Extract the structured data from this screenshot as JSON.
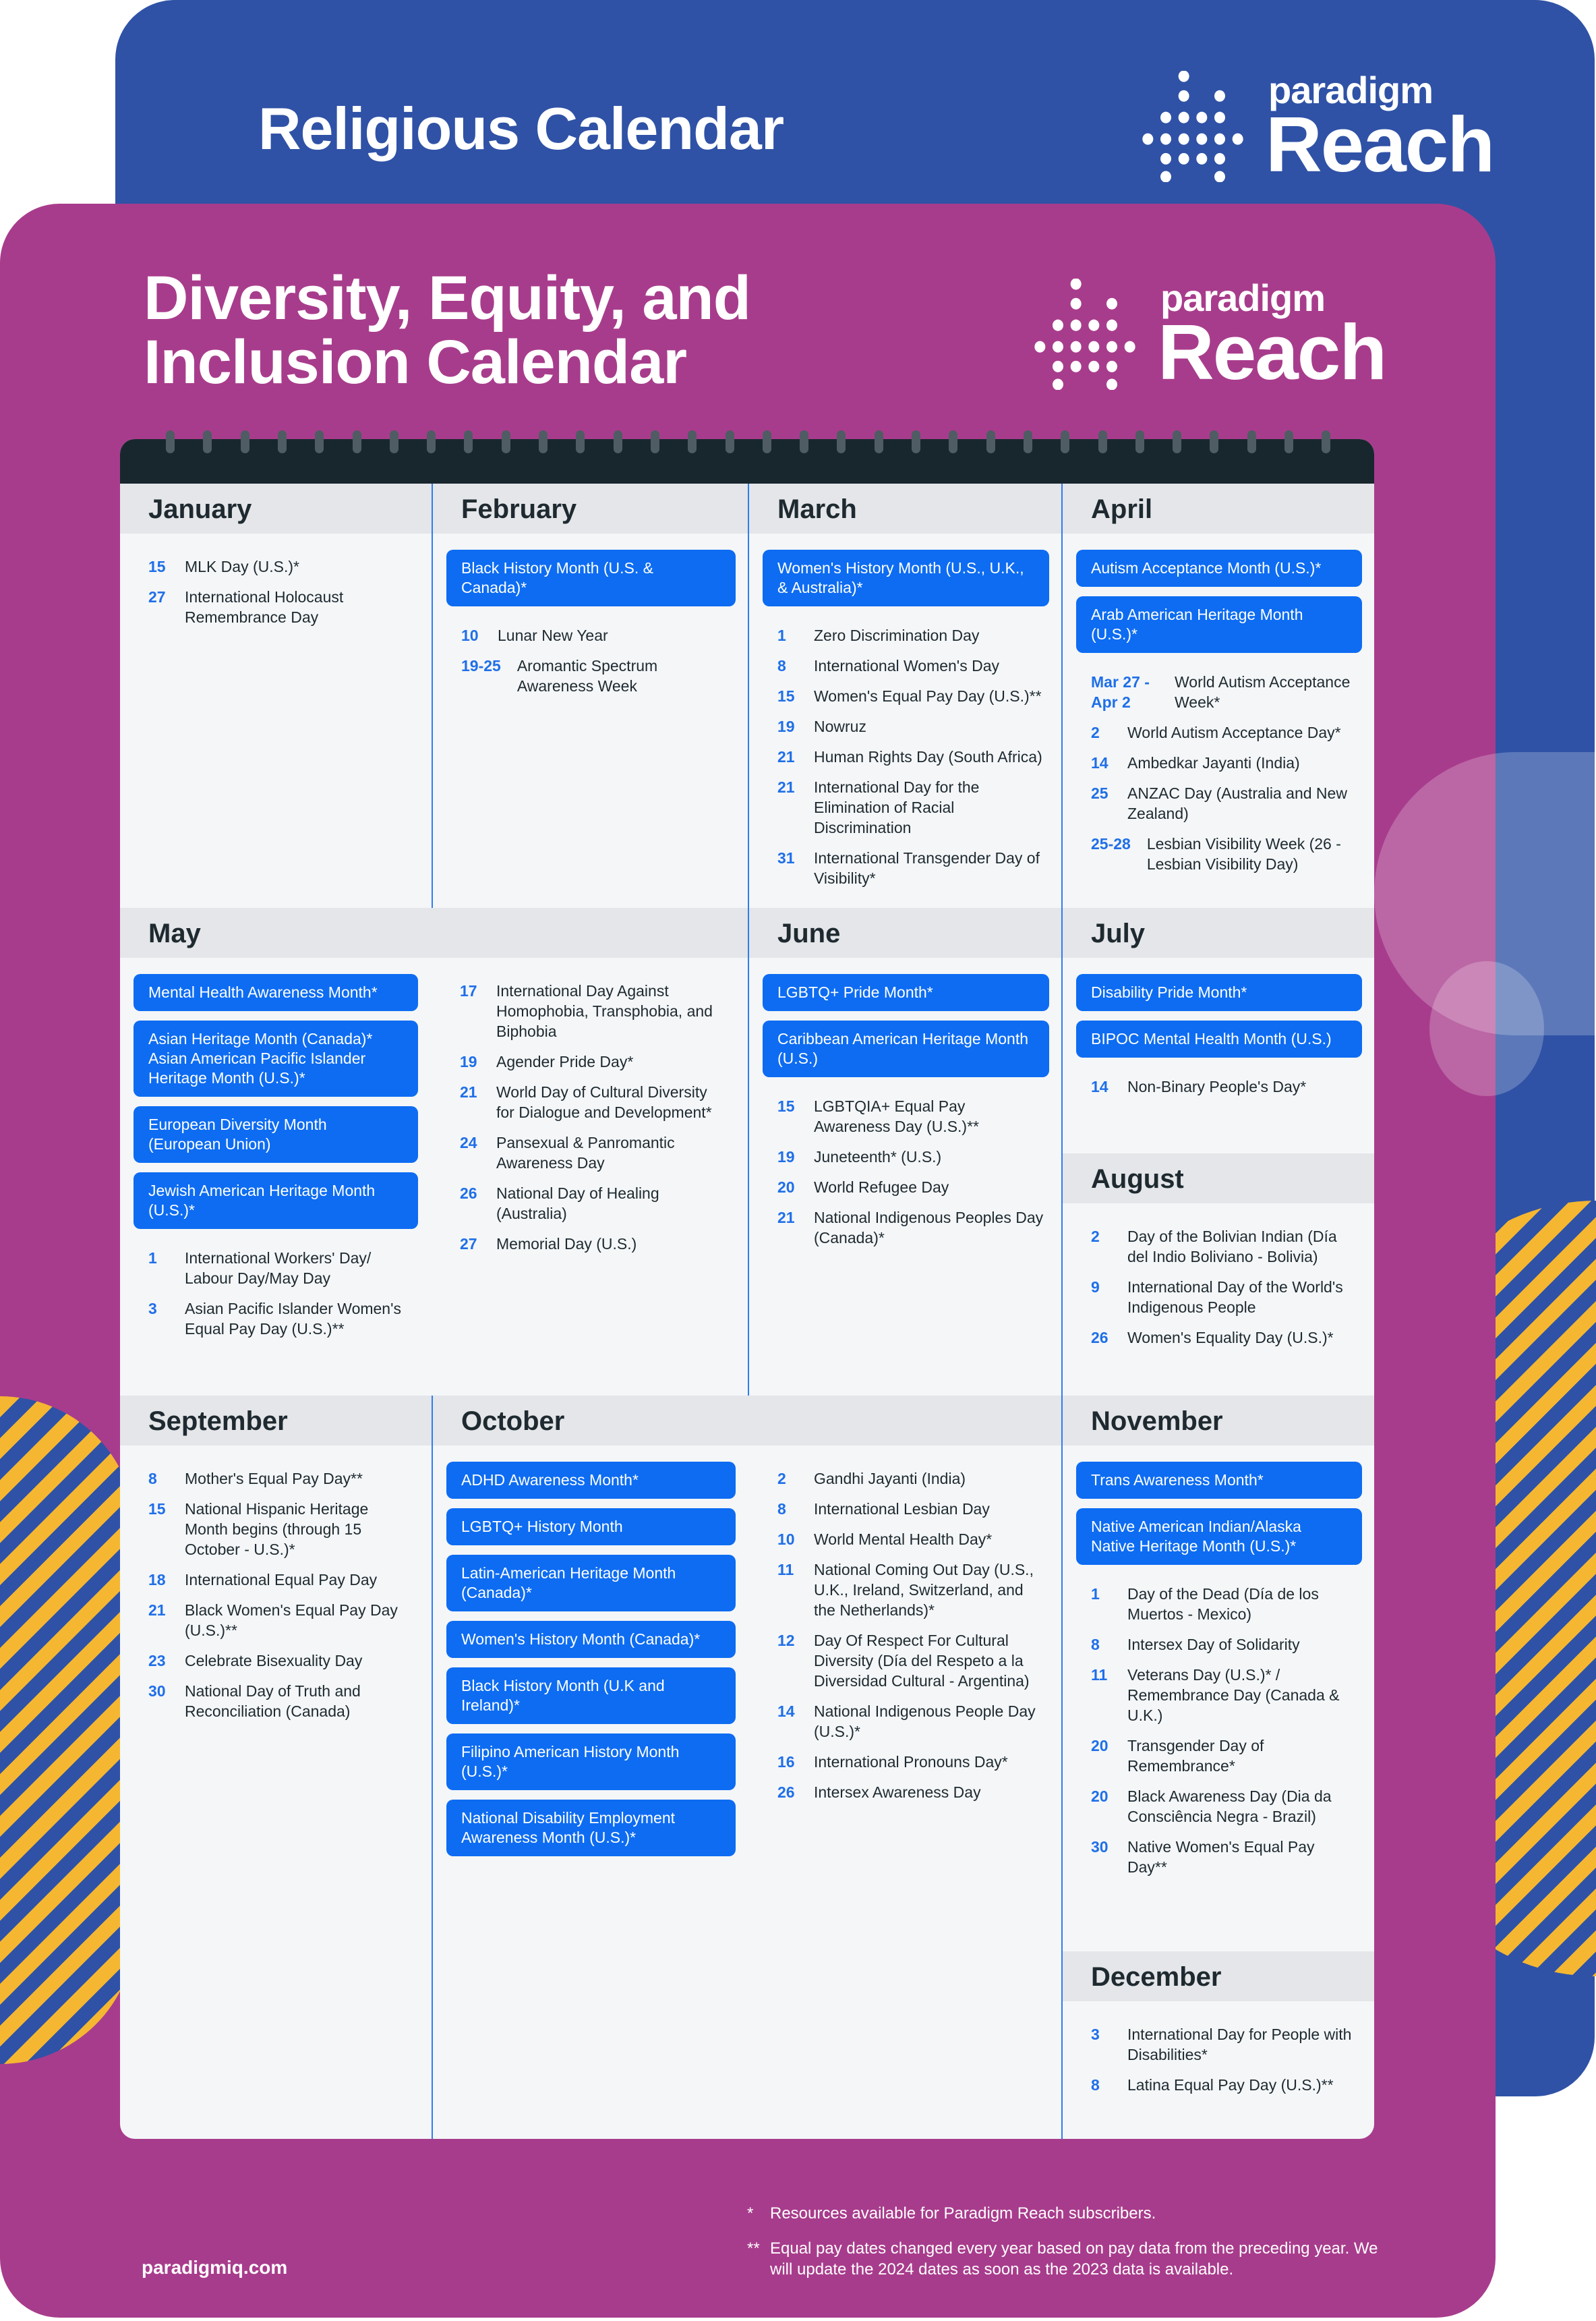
{
  "back_card": {
    "title": "Religious Calendar"
  },
  "front_card": {
    "title_line1": "Diversity, Equity, and",
    "title_line2": "Inclusion Calendar"
  },
  "logo": {
    "small": "paradigm",
    "large": "Reach"
  },
  "colors": {
    "back_card": "#2f52a6",
    "front_card": "#a83c8c",
    "highlight": "#0d6cf2",
    "date": "#1f6fe8",
    "stripe_yellow": "#f5b731"
  },
  "calendar": {
    "months": [
      {
        "name": "January",
        "columns": [
          {
            "highlights": [],
            "events": [
              {
                "date": "15",
                "label": "MLK Day (U.S.)*"
              },
              {
                "date": "27",
                "label": "International Holocaust Remembrance Day"
              }
            ]
          }
        ]
      },
      {
        "name": "February",
        "columns": [
          {
            "highlights": [
              "Black History Month (U.S. & Canada)*"
            ],
            "events": [
              {
                "date": "10",
                "label": "Lunar New Year"
              },
              {
                "date": "19-25",
                "label": "Aromantic Spectrum Awareness Week"
              }
            ]
          }
        ]
      },
      {
        "name": "March",
        "columns": [
          {
            "highlights": [
              "Women's History Month (U.S., U.K., & Australia)*"
            ],
            "events": [
              {
                "date": "1",
                "label": "Zero Discrimination Day"
              },
              {
                "date": "8",
                "label": "International Women's Day"
              },
              {
                "date": "15",
                "label": "Women's Equal Pay Day (U.S.)**"
              },
              {
                "date": "19",
                "label": "Nowruz"
              },
              {
                "date": "21",
                "label": "Human Rights Day (South Africa)"
              },
              {
                "date": "21",
                "label": "International Day for the Elimination of Racial Discrimination"
              },
              {
                "date": "31",
                "label": "International Transgender Day of Visibility*"
              }
            ]
          }
        ]
      },
      {
        "name": "April",
        "columns": [
          {
            "highlights": [
              "Autism Acceptance Month (U.S.)*",
              "Arab American Heritage Month (U.S.)*"
            ],
            "events": [
              {
                "date": "Mar 27 - Apr 2",
                "label": "World Autism Acceptance Week*"
              },
              {
                "date": "2",
                "label": "World Autism Acceptance Day*"
              },
              {
                "date": "14",
                "label": "Ambedkar Jayanti (India)"
              },
              {
                "date": "25",
                "label": "ANZAC Day (Australia and New Zealand)"
              },
              {
                "date": "25-28",
                "label": "Lesbian Visibility Week (26 -Lesbian Visibility Day)"
              }
            ]
          }
        ]
      },
      {
        "name": "May",
        "columns": [
          {
            "highlights": [
              "Mental Health Awareness Month*",
              "Asian Heritage Month (Canada)*\nAsian American Pacific Islander Heritage Month (U.S.)*",
              "European Diversity Month (European Union)",
              "Jewish American Heritage Month (U.S.)*"
            ],
            "events": [
              {
                "date": "1",
                "label": "International Workers' Day/ Labour Day/May Day"
              },
              {
                "date": "3",
                "label": "Asian Pacific Islander Women's Equal Pay Day (U.S.)**"
              }
            ]
          },
          {
            "highlights": [],
            "events": [
              {
                "date": "17",
                "label": "International Day Against Homophobia, Transphobia, and Biphobia"
              },
              {
                "date": "19",
                "label": "Agender Pride Day*"
              },
              {
                "date": "21",
                "label": "World Day of Cultural Diversity for Dialogue and Development*"
              },
              {
                "date": "24",
                "label": "Pansexual & Panromantic Awareness Day"
              },
              {
                "date": "26",
                "label": "National Day of Healing (Australia)"
              },
              {
                "date": "27",
                "label": "Memorial Day (U.S.)"
              }
            ]
          }
        ]
      },
      {
        "name": "June",
        "columns": [
          {
            "highlights": [
              "LGBTQ+ Pride Month*",
              "Caribbean American Heritage Month (U.S.)"
            ],
            "events": [
              {
                "date": "15",
                "label": "LGBTQIA+ Equal Pay Awareness Day (U.S.)**"
              },
              {
                "date": "19",
                "label": "Juneteenth* (U.S.)"
              },
              {
                "date": "20",
                "label": "World Refugee Day"
              },
              {
                "date": "21",
                "label": "National Indigenous Peoples Day (Canada)*"
              }
            ]
          }
        ]
      },
      {
        "name": "July",
        "columns": [
          {
            "highlights": [
              "Disability Pride Month*",
              "BIPOC Mental Health Month (U.S.)"
            ],
            "events": [
              {
                "date": "14",
                "label": "Non-Binary People's Day*"
              }
            ]
          }
        ]
      },
      {
        "name": "August",
        "columns": [
          {
            "highlights": [],
            "events": [
              {
                "date": "2",
                "label": "Day of the Bolivian Indian (Día del Indio Boliviano - Bolivia)"
              },
              {
                "date": "9",
                "label": "International Day of the World's Indigenous People"
              },
              {
                "date": "26",
                "label": "Women's Equality Day (U.S.)*"
              }
            ]
          }
        ]
      },
      {
        "name": "September",
        "columns": [
          {
            "highlights": [],
            "events": [
              {
                "date": "8",
                "label": "Mother's Equal Pay Day**"
              },
              {
                "date": "15",
                "label": "National Hispanic Heritage Month begins (through 15 October - U.S.)*"
              },
              {
                "date": "18",
                "label": "International Equal Pay Day"
              },
              {
                "date": "21",
                "label": "Black Women's Equal Pay Day (U.S.)**"
              },
              {
                "date": "23",
                "label": "Celebrate Bisexuality Day"
              },
              {
                "date": "30",
                "label": "National Day of Truth and Reconciliation (Canada)"
              }
            ]
          }
        ]
      },
      {
        "name": "October",
        "columns": [
          {
            "highlights": [
              "ADHD Awareness Month*",
              "LGBTQ+ History Month",
              "Latin-American Heritage Month (Canada)*",
              "Women's History Month (Canada)*",
              "Black History Month (U.K and Ireland)*",
              "Filipino American History Month (U.S.)*",
              "National Disability Employment Awareness Month (U.S.)*"
            ],
            "events": []
          },
          {
            "highlights": [],
            "events": [
              {
                "date": "2",
                "label": "Gandhi Jayanti (India)"
              },
              {
                "date": "8",
                "label": "International Lesbian Day"
              },
              {
                "date": "10",
                "label": "World Mental Health Day*"
              },
              {
                "date": "11",
                "label": "National Coming Out Day (U.S., U.K., Ireland, Switzerland, and the Netherlands)*"
              },
              {
                "date": "12",
                "label": "Day Of Respect For Cultural Diversity (Día del Respeto a la Diversidad Cultural - Argentina)"
              },
              {
                "date": "14",
                "label": "National Indigenous People Day (U.S.)*"
              },
              {
                "date": "16",
                "label": "International Pronouns Day*"
              },
              {
                "date": "26",
                "label": "Intersex Awareness Day"
              }
            ]
          }
        ]
      },
      {
        "name": "November",
        "columns": [
          {
            "highlights": [
              "Trans Awareness Month*",
              "Native American Indian/Alaska Native Heritage Month (U.S.)*"
            ],
            "events": [
              {
                "date": "1",
                "label": "Day of the Dead (Día de los Muertos - Mexico)"
              },
              {
                "date": "8",
                "label": "Intersex Day of Solidarity"
              },
              {
                "date": "11",
                "label": "Veterans Day (U.S.)* / Remembrance Day (Canada & U.K.)"
              },
              {
                "date": "20",
                "label": "Transgender Day of Remembrance*"
              },
              {
                "date": "20",
                "label": "Black Awareness Day (Dia da Consciência Negra - Brazil)"
              },
              {
                "date": "30",
                "label": "Native Women's Equal Pay Day**"
              }
            ]
          }
        ]
      },
      {
        "name": "December",
        "columns": [
          {
            "highlights": [],
            "events": [
              {
                "date": "3",
                "label": "International Day for People with Disabilities*"
              },
              {
                "date": "8",
                "label": "Latina Equal Pay Day (U.S.)**"
              }
            ]
          }
        ]
      }
    ]
  },
  "footnotes": [
    {
      "mark": "*",
      "text": "Resources available for Paradigm Reach subscribers."
    },
    {
      "mark": "**",
      "text": "Equal pay dates changed every year based on pay data from the preceding year. We will update the 2024 dates as soon as the 2023 data is available."
    }
  ],
  "footer": {
    "website": "paradigmiq.com"
  }
}
